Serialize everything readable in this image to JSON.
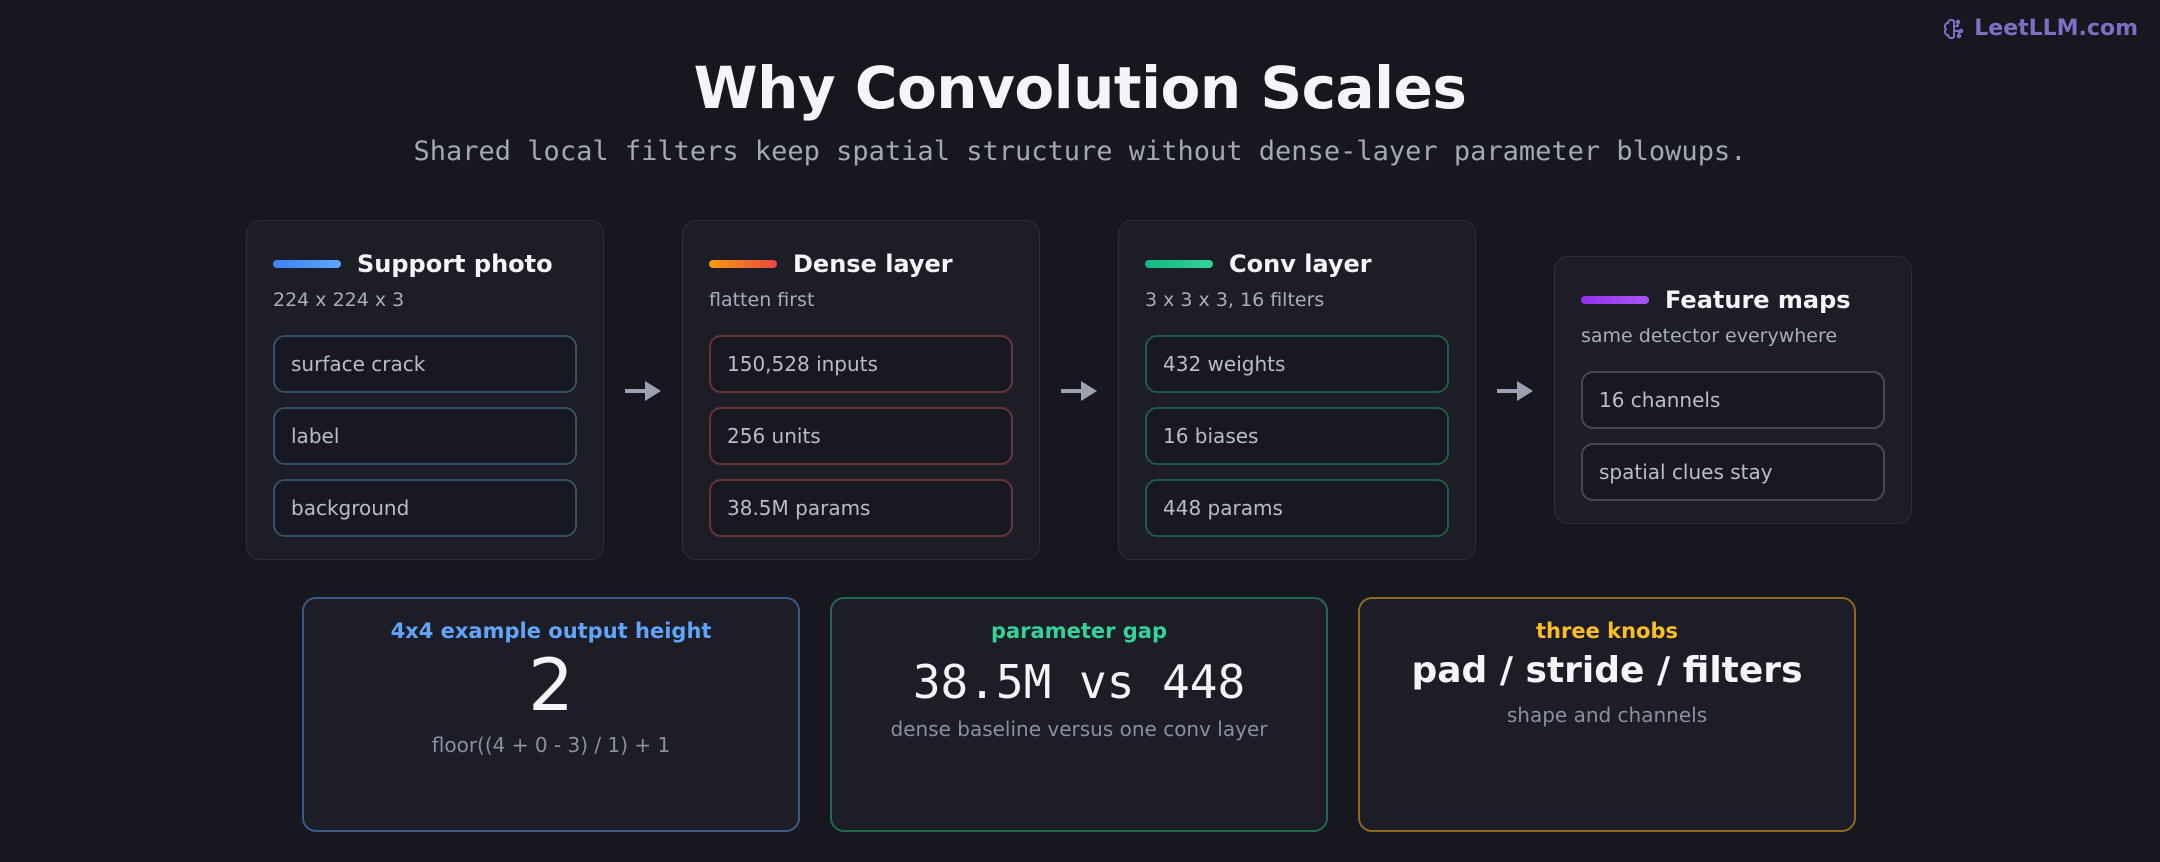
{
  "brand": {
    "name": "LeetLLM.com",
    "color": "#7d6fc4"
  },
  "header": {
    "title": "Why Convolution Scales",
    "subtitle": "Shared local filters keep spatial structure without dense-layer parameter blowups."
  },
  "cards": [
    {
      "title": "Support photo",
      "subtitle": "224 x 224 x 3",
      "accent": "#3b82f6",
      "items": [
        "surface crack",
        "label",
        "background"
      ]
    },
    {
      "title": "Dense layer",
      "subtitle": "flatten first",
      "accent": "#f97316",
      "items": [
        "150,528 inputs",
        "256 units",
        "38.5M params"
      ]
    },
    {
      "title": "Conv layer",
      "subtitle": "3 x 3 x 3, 16 filters",
      "accent": "#10b981",
      "items": [
        "432 weights",
        "16 biases",
        "448 params"
      ]
    },
    {
      "title": "Feature maps",
      "subtitle": "same detector everywhere",
      "accent": "#a855f7",
      "items": [
        "16 channels",
        "spatial clues stay"
      ]
    }
  ],
  "stats": [
    {
      "label": "4x4 example output height",
      "value": "2",
      "note": "floor((4 + 0 - 3) / 1) + 1",
      "color": "#60a5fa"
    },
    {
      "label": "parameter gap",
      "value": "38.5M vs 448",
      "note": "dense baseline versus one conv layer",
      "color": "#34d399"
    },
    {
      "label": "three knobs",
      "value": "pad / stride / filters",
      "note": "shape and channels",
      "color": "#fbbf24"
    }
  ]
}
